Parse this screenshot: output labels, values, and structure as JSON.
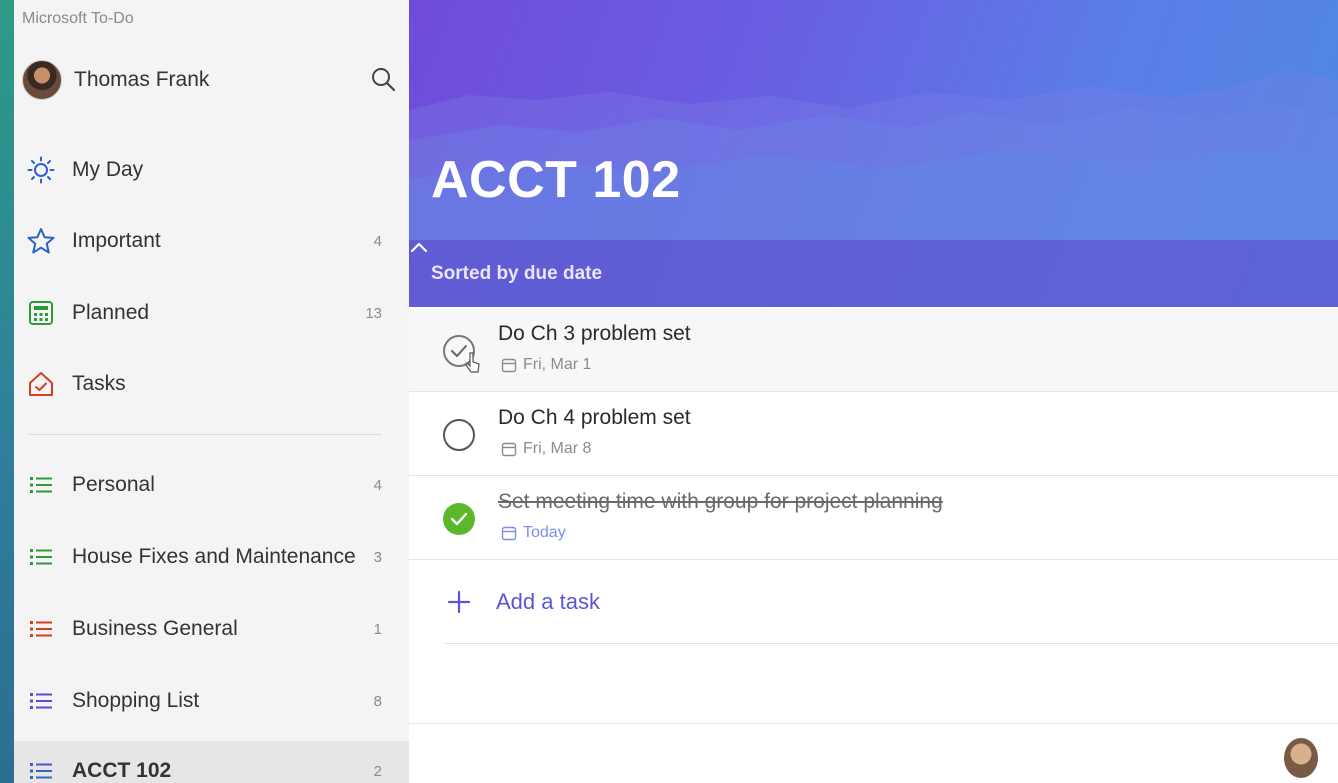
{
  "app": {
    "title": "Microsoft To-Do"
  },
  "profile": {
    "name": "Thomas Frank"
  },
  "smart_lists": [
    {
      "label": "My Day",
      "icon": "sun-icon",
      "count": ""
    },
    {
      "label": "Important",
      "icon": "star-icon",
      "count": "4"
    },
    {
      "label": "Planned",
      "icon": "calendar-grid-icon",
      "count": "13"
    },
    {
      "label": "Tasks",
      "icon": "house-icon",
      "count": ""
    }
  ],
  "custom_lists": [
    {
      "label": "Personal",
      "icon": "list-icon",
      "color": "#2e9b3a",
      "count": "4"
    },
    {
      "label": "House Fixes and Maintenance",
      "icon": "list-icon",
      "color": "#2e9b3a",
      "count": "3"
    },
    {
      "label": "Business General",
      "icon": "list-icon",
      "color": "#d2401f",
      "count": "1"
    },
    {
      "label": "Shopping List",
      "icon": "list-icon",
      "color": "#5b4fcf",
      "count": "8"
    },
    {
      "label": "ACCT 102",
      "icon": "list-icon",
      "color": "#3a63c9",
      "count": "2"
    }
  ],
  "main": {
    "list_title": "ACCT 102",
    "sort_label": "Sorted by due date",
    "tasks": [
      {
        "title": "Do Ch 3 problem set",
        "date": "Fri, Mar 1",
        "completed": false
      },
      {
        "title": "Do Ch 4 problem set",
        "date": "Fri, Mar 8",
        "completed": false
      },
      {
        "title": "Set meeting time with group for project planning",
        "date": "Today",
        "completed": true
      }
    ],
    "add_task_label": "Add a task"
  },
  "colors": {
    "accent": "#5a57d6",
    "complete": "#5cb82a",
    "hero_start": "#6f4bd9",
    "hero_end": "#4f8ae4"
  }
}
